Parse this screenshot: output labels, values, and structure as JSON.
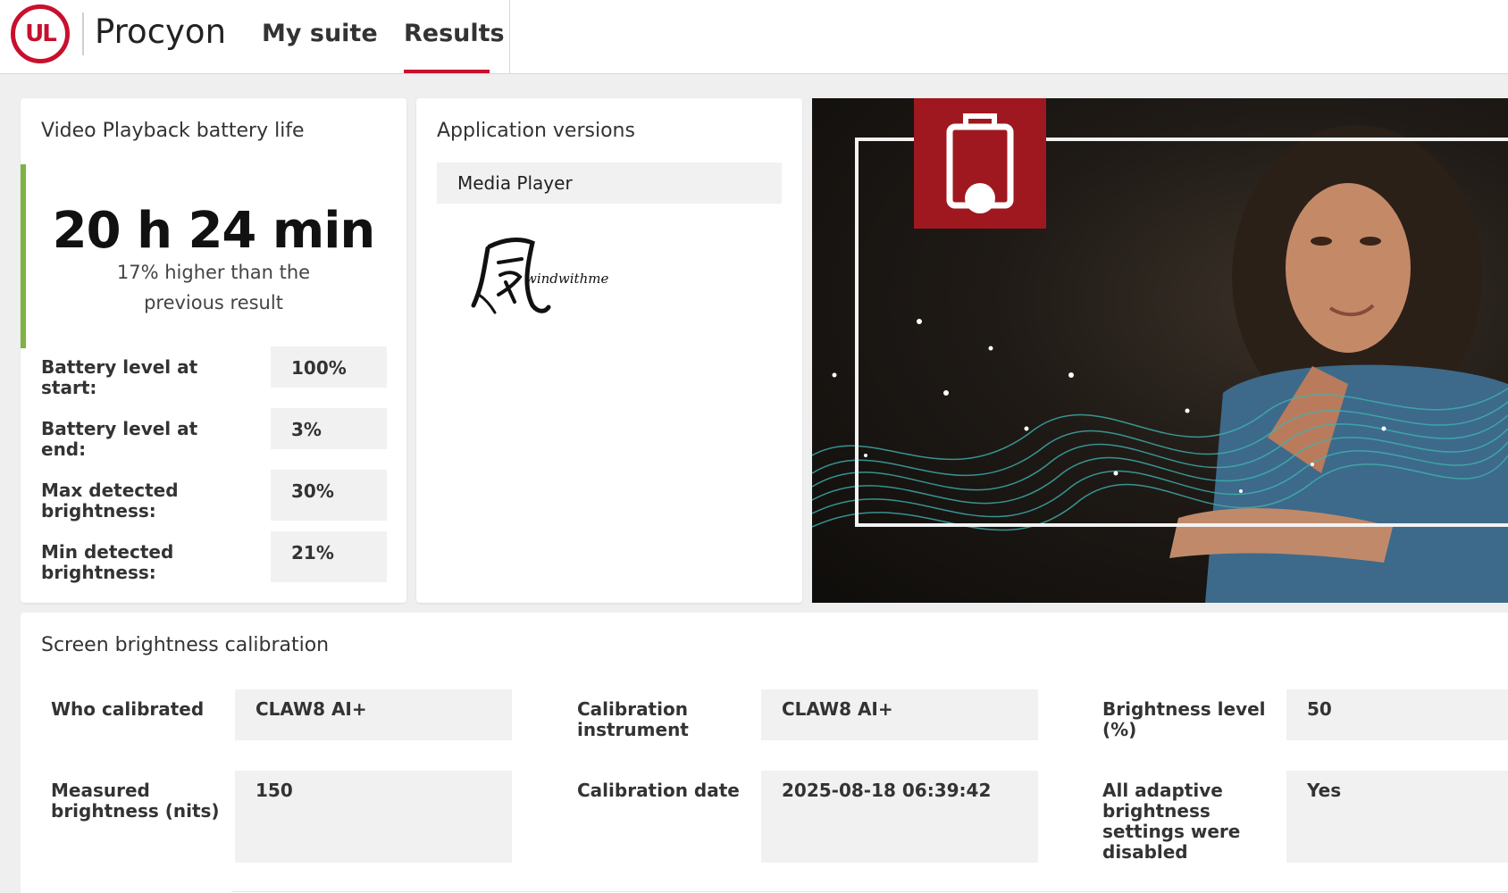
{
  "header": {
    "logo_text": "UL",
    "app_name": "Procyon",
    "tabs": [
      {
        "label": "My suite",
        "active": false
      },
      {
        "label": "Results",
        "active": true
      }
    ],
    "accent_color": "#c8102e"
  },
  "battery": {
    "title": "Video Playback battery life",
    "result": "20 h 24 min",
    "comparison": "17% higher than the previous result",
    "accent_color": "#7cb342",
    "rows": [
      {
        "label": "Battery level at start:",
        "value": "100%"
      },
      {
        "label": "Battery level at end:",
        "value": "3%"
      },
      {
        "label": "Max detected brightness:",
        "value": "30%"
      },
      {
        "label": "Min detected brightness:",
        "value": "21%"
      }
    ]
  },
  "apps": {
    "title": "Application versions",
    "items": [
      "Media Player"
    ],
    "watermark": "windwithme"
  },
  "hero": {
    "icon": "battery-charging-icon",
    "badge_color": "#a0181f"
  },
  "calibration": {
    "title": "Screen brightness calibration",
    "fields": [
      {
        "label": "Who calibrated",
        "value": "CLAW8 AI+"
      },
      {
        "label": "Calibration instrument",
        "value": "CLAW8 AI+"
      },
      {
        "label": "Brightness level (%)",
        "value": "50"
      },
      {
        "label": "Measured brightness (nits)",
        "value": "150"
      },
      {
        "label": "Calibration date",
        "value": "2025-08-18 06:39:42"
      },
      {
        "label": "All adaptive brightness settings were disabled",
        "value": "Yes"
      }
    ]
  }
}
